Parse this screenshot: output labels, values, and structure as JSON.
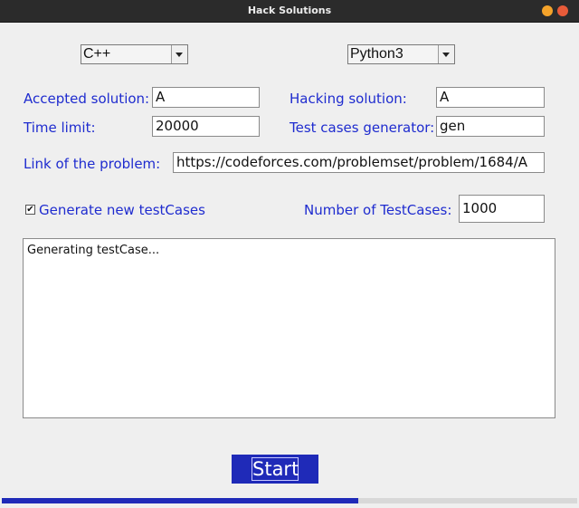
{
  "window": {
    "title": "Hack Solutions"
  },
  "languages": {
    "left_selected": "C++",
    "right_selected": "Python3"
  },
  "form": {
    "accepted_label": "Accepted solution:",
    "accepted_value": "A",
    "hacking_label": "Hacking solution:",
    "hacking_value": "A",
    "time_label": "Time limit:",
    "time_value": "20000",
    "generator_label": "Test cases generator:",
    "generator_value": "gen",
    "link_label": "Link of the problem:",
    "link_value": "https://codeforces.com/problemset/problem/1684/A",
    "generate_label": "Generate new testCases",
    "generate_checked": true,
    "number_label": "Number of TestCases:",
    "number_value": "1000"
  },
  "output": {
    "text": "Generating testCase..."
  },
  "actions": {
    "start_label": "Start"
  },
  "progress": {
    "fraction": 0.62
  },
  "colors": {
    "accent": "#1f2ab8",
    "label": "#1f2ccf"
  },
  "icons": {
    "checkbox": "check-icon",
    "dropdown": "chevron-down-icon"
  }
}
